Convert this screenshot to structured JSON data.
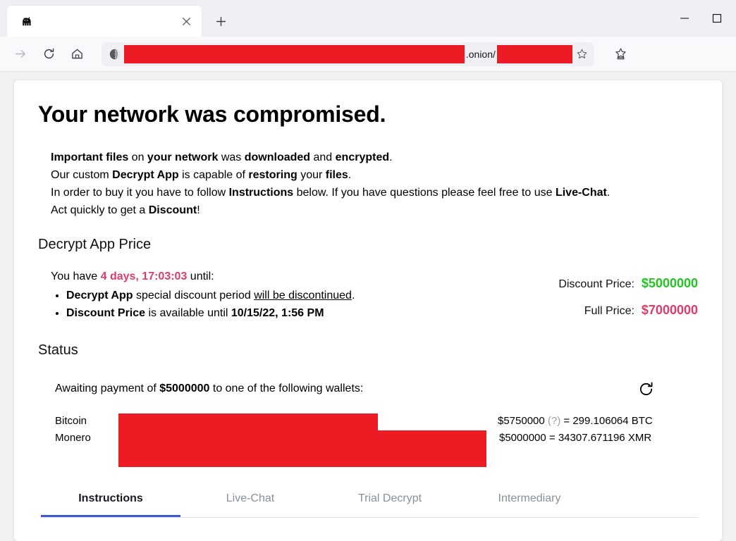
{
  "browser": {
    "tab": {
      "title": "",
      "favicon_icon": "black-cat-icon",
      "close_icon": "close-icon"
    },
    "newtab_icon": "plus-icon",
    "window_controls": {
      "minimize_icon": "minimize-icon",
      "maximize_icon": "maximize-icon"
    },
    "nav": {
      "forward_icon": "forward-arrow-icon",
      "reload_icon": "reload-icon",
      "home_icon": "home-icon",
      "onion_icon": "tor-onion-circuit-icon",
      "star_icon": "bookmark-star-icon",
      "library_icon": "save-to-bookmarks-icon"
    },
    "url": {
      "redacted_host": "",
      "tld": ".onion/",
      "redacted_path": ""
    }
  },
  "page": {
    "title": "Your network was compromised.",
    "intro": [
      {
        "parts": [
          {
            "t": "Important files",
            "b": true
          },
          {
            "t": " on ",
            "b": false
          },
          {
            "t": "your network",
            "b": true
          },
          {
            "t": " was ",
            "b": false
          },
          {
            "t": "downloaded",
            "b": true
          },
          {
            "t": " and ",
            "b": false
          },
          {
            "t": "encrypted",
            "b": true
          },
          {
            "t": ".",
            "b": false
          }
        ]
      },
      {
        "parts": [
          {
            "t": "Our custom ",
            "b": false
          },
          {
            "t": "Decrypt App",
            "b": true
          },
          {
            "t": " is capable of ",
            "b": false
          },
          {
            "t": "restoring",
            "b": true
          },
          {
            "t": " your ",
            "b": false
          },
          {
            "t": "files",
            "b": true
          },
          {
            "t": ".",
            "b": false
          }
        ]
      },
      {
        "parts": [
          {
            "t": "In order to buy it you have to follow ",
            "b": false
          },
          {
            "t": "Instructions",
            "b": true
          },
          {
            "t": " below. If you have questions please feel free to use ",
            "b": false
          },
          {
            "t": "Live-Chat",
            "b": true
          },
          {
            "t": ".",
            "b": false
          }
        ]
      },
      {
        "parts": [
          {
            "t": "Act quickly to get a ",
            "b": false
          },
          {
            "t": "Discount",
            "b": true
          },
          {
            "t": "!",
            "b": false
          }
        ]
      }
    ],
    "price_section": {
      "heading": "Decrypt App Price",
      "countdown_prefix": "You have ",
      "countdown_value": "4 days, 17:03:03",
      "countdown_suffix": " until:",
      "bullets": [
        {
          "parts": [
            {
              "t": "Decrypt App",
              "b": true
            },
            {
              "t": " special discount period ",
              "b": false
            },
            {
              "t": "will be discontinued",
              "b": false,
              "u": true
            },
            {
              "t": ".",
              "b": false
            }
          ]
        },
        {
          "parts": [
            {
              "t": "Discount Price",
              "b": true
            },
            {
              "t": " is available until ",
              "b": false
            },
            {
              "t": "10/15/22, 1:56 PM",
              "b": true
            }
          ]
        }
      ],
      "discount_label": "Discount Price:",
      "discount_value": "$5000000",
      "discount_color": "#22c522",
      "full_label": "Full Price:",
      "full_value": "$7000000",
      "full_color": "#e23b67"
    },
    "status_section": {
      "heading": "Status",
      "await_prefix": "Awaiting payment of ",
      "await_amount": "$5000000",
      "await_suffix": " to one of the following wallets:",
      "refresh_icon": "refresh-icon",
      "wallets": [
        {
          "name": "Bitcoin",
          "address_redacted": "",
          "addr_w": 368,
          "addr_h": 24,
          "amount_usd": "$5750000",
          "qmark": "(?)",
          "equals": " = ",
          "crypto_amount": "299.106064 BTC"
        },
        {
          "name": "Monero",
          "address_redacted": "",
          "addr_w": 522,
          "addr_h": 52,
          "amount_usd": "$5000000",
          "qmark": "",
          "equals": " = ",
          "crypto_amount": "34307.671196 XMR"
        }
      ]
    },
    "tabs": [
      {
        "label": "Instructions",
        "active": true
      },
      {
        "label": "Live-Chat",
        "active": false
      },
      {
        "label": "Trial Decrypt",
        "active": false
      },
      {
        "label": "Intermediary",
        "active": false
      }
    ],
    "accent_color": "#3b5bdb",
    "redaction_color": "#ed1c24"
  }
}
